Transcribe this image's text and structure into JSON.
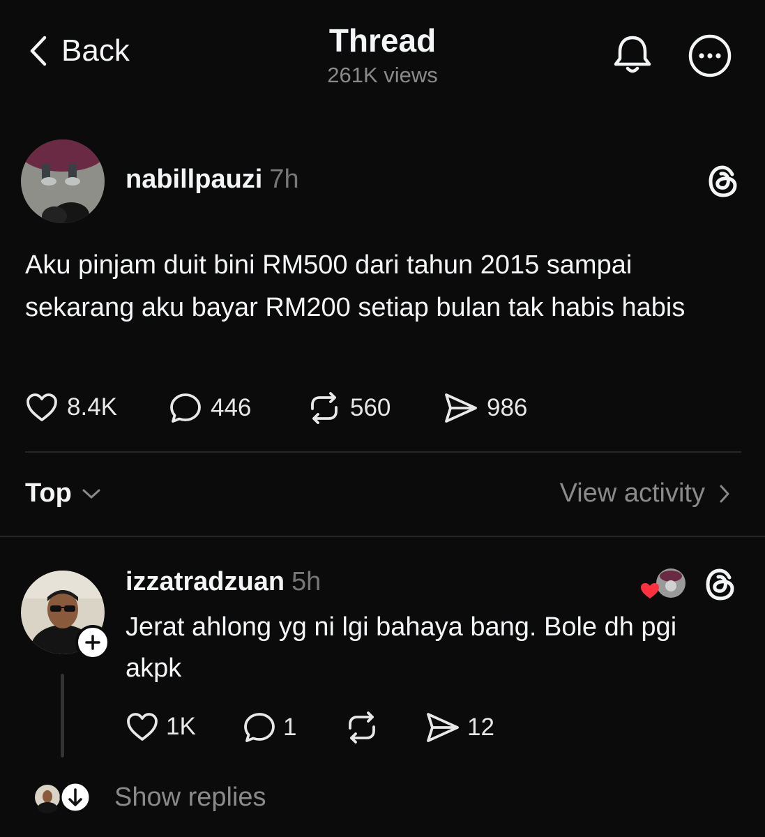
{
  "header": {
    "back_label": "Back",
    "title": "Thread",
    "views": "261K views"
  },
  "post": {
    "username": "nabillpauzi",
    "time": "7h",
    "text": "Aku pinjam duit bini RM500 dari tahun 2015 sampai sekarang aku bayar RM200 setiap bulan tak habis habis",
    "likes": "8.4K",
    "comments": "446",
    "reposts": "560",
    "shares": "986"
  },
  "sort": {
    "label": "Top",
    "view_activity": "View activity"
  },
  "reply": {
    "username": "izzatradzuan",
    "time": "5h",
    "text": "Jerat ahlong yg ni lgi bahaya bang. Bole dh pgi akpk",
    "likes": "1K",
    "comments": "1",
    "shares": "12"
  },
  "show_replies": "Show replies",
  "colors": {
    "background": "#0b0b0b",
    "text": "#f3f5f7",
    "muted": "#8a8a8a",
    "like_heart": "#ff3040"
  },
  "icons": [
    "chevron-left-icon",
    "bell-icon",
    "more-icon",
    "threads-logo-icon",
    "heart-icon",
    "comment-icon",
    "repost-icon",
    "share-icon",
    "chevron-down-icon",
    "chevron-right-icon",
    "plus-icon",
    "arrow-down-icon"
  ]
}
